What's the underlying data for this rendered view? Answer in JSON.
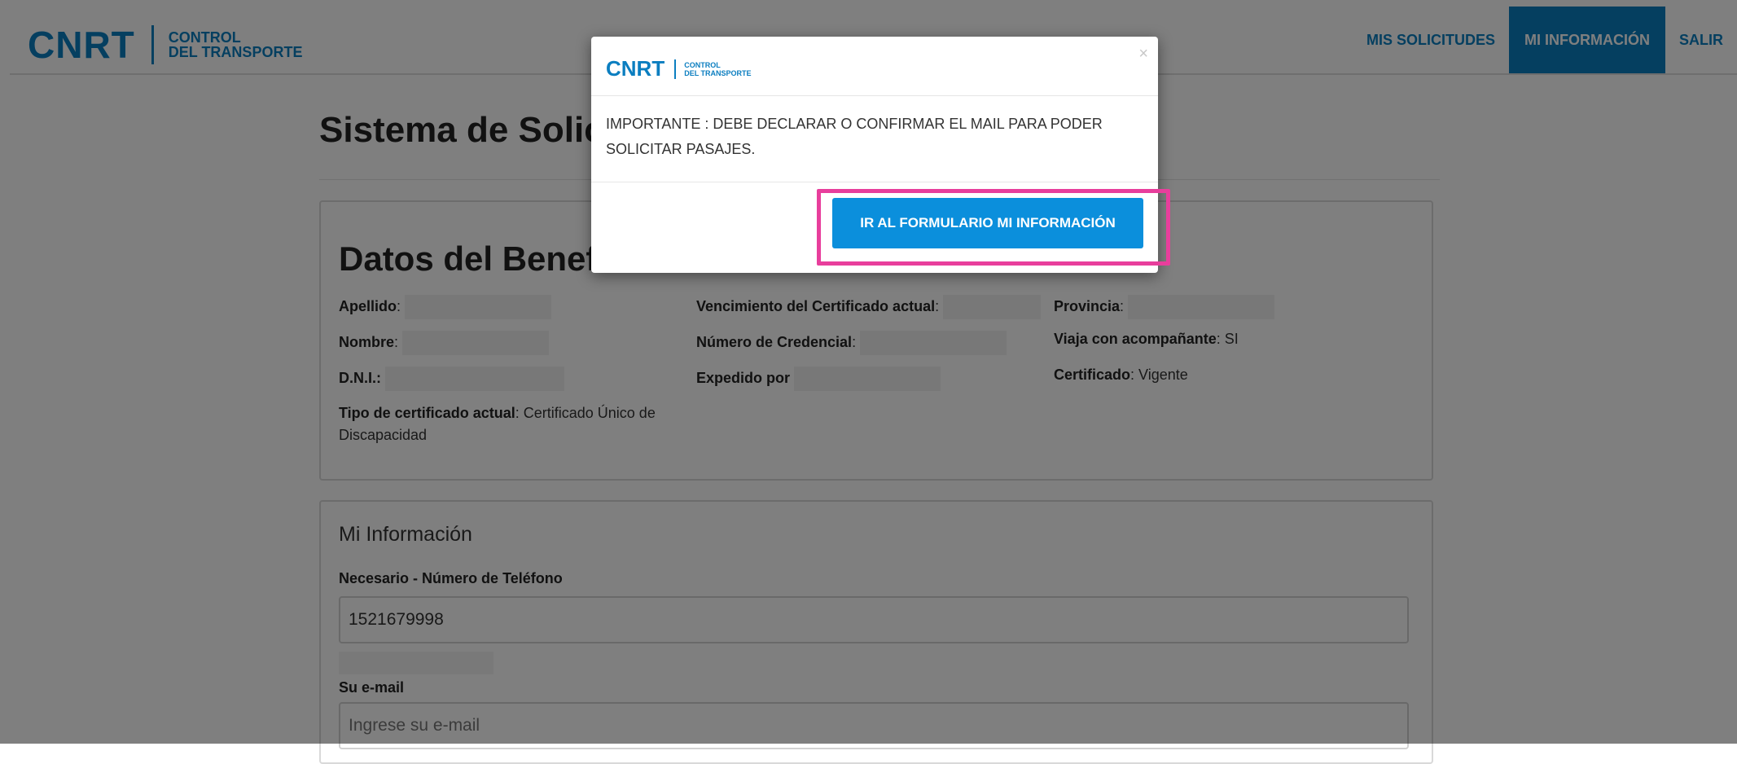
{
  "header": {
    "brand_main": "CNRT",
    "brand_sub_line1": "CONTROL",
    "brand_sub_line2": "DEL TRANSPORTE",
    "nav": [
      {
        "label": "MIS SOLICITUDES",
        "active": false
      },
      {
        "label": "MI INFORMACIÓN",
        "active": true
      },
      {
        "label": "SALIR",
        "active": false
      }
    ]
  },
  "page": {
    "title": "Sistema de Solicitudes"
  },
  "beneficiario": {
    "heading": "Datos del Beneficiario",
    "fields": {
      "apellido_label": "Apellido",
      "nombre_label": "Nombre",
      "dni_label": "D.N.I.:",
      "tipo_cert_label": "Tipo de certificado actual",
      "tipo_cert_value": "Certificado Único de Discapacidad",
      "vencimiento_label": "Vencimiento del Certificado actual",
      "credencial_label": "Número de Credencial",
      "expedido_label": "Expedido por",
      "provincia_label": "Provincia",
      "acompanante_label": "Viaja con acompañante",
      "acompanante_value": "SI",
      "certificado_label": "Certificado",
      "certificado_value": "Vigente"
    }
  },
  "mi_informacion": {
    "heading": "Mi Información",
    "phone_label": "Necesario - Número de Teléfono",
    "phone_value": "1521679998",
    "email_label": "Su e-mail",
    "email_placeholder": "Ingrese su e-mail"
  },
  "modal": {
    "logo_main": "CNRT",
    "logo_sub_line1": "CONTROL",
    "logo_sub_line2": "DEL TRANSPORTE",
    "close": "×",
    "message": "IMPORTANTE : DEBE DECLARAR O CONFIRMAR EL MAIL PARA PODER SOLICITAR PASAJES.",
    "button_label": "IR AL FORMULARIO MI INFORMACIÓN",
    "highlight_color": "#e83e9c"
  },
  "colors": {
    "brand": "#0b7ec0",
    "button": "#0b8fdc"
  }
}
